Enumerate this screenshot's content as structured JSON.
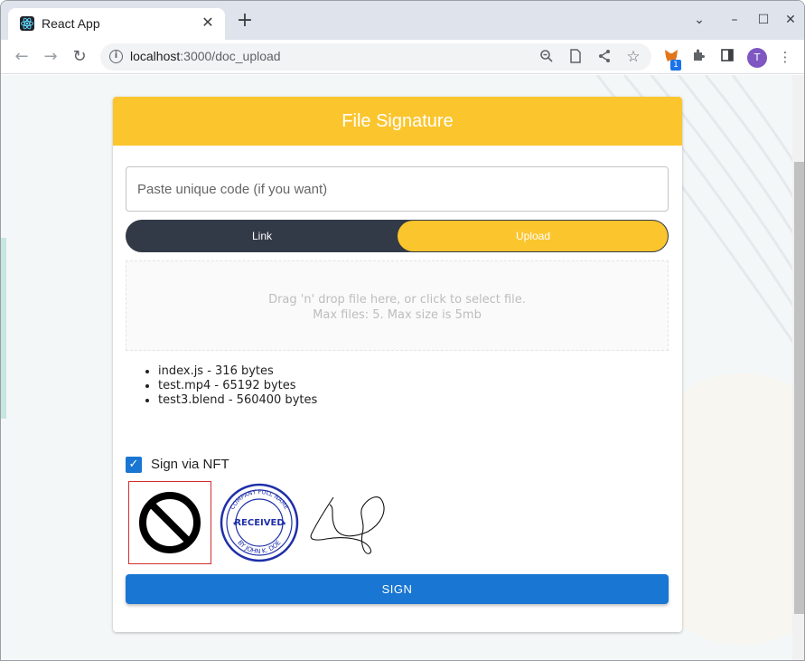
{
  "browser": {
    "tab_title": "React App",
    "url_host": "localhost",
    "url_path": ":3000/doc_upload",
    "extension_badge": "1",
    "profile_initial": "T"
  },
  "card": {
    "title": "File Signature",
    "code_placeholder": "Paste unique code (if you want)",
    "toggle": {
      "options": [
        "Link",
        "Upload"
      ],
      "selected": "Upload"
    },
    "dropzone": {
      "line1": "Drag 'n' drop file here, or click to select file.",
      "line2": "Max files: 5. Max size is 5mb"
    },
    "files": [
      "index.js - 316 bytes",
      "test.mp4 - 65192 bytes",
      "test3.blend - 560400 bytes"
    ],
    "nft": {
      "label": "Sign via NFT",
      "checked": true
    },
    "signature_options": [
      "none",
      "stamp",
      "handwritten"
    ],
    "stamp_text": {
      "center": "RECEIVED",
      "top": "COMPANY FULL NAME",
      "bottom": "BY JOHN K. DOE"
    },
    "sign_button": "SIGN"
  },
  "colors": {
    "header": "#fbc52e",
    "toggle_dark": "#333a47",
    "primary": "#1976d2",
    "stamp": "#1e2fa8"
  }
}
